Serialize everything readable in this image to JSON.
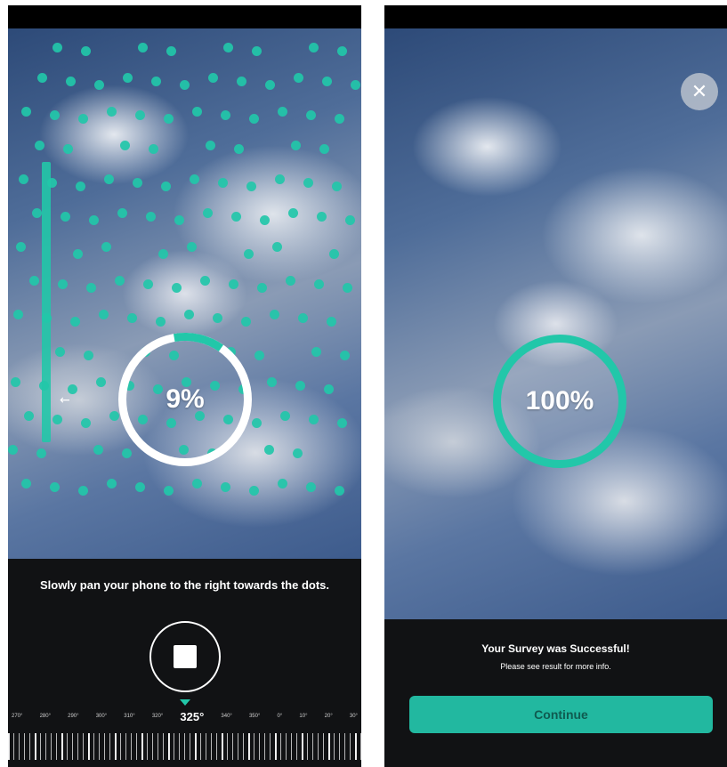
{
  "left_screen": {
    "progress_label": "9%",
    "progress_value": 0.09,
    "instruction": "Slowly pan your phone to the right towards the dots.",
    "compass": {
      "labels": [
        "270°",
        "280°",
        "290°",
        "300°",
        "310°",
        "320°",
        "325°",
        "340°",
        "350°",
        "0°",
        "10°",
        "20°",
        "30°"
      ],
      "current": "325°"
    },
    "stop_button_icon": "stop-icon"
  },
  "right_screen": {
    "progress_label": "100%",
    "progress_value": 1.0,
    "close_icon": "close-icon",
    "success_title": "Your Survey was Successful!",
    "success_subtitle": "Please see result for more info.",
    "continue_label": "Continue"
  },
  "colors": {
    "accent": "#22c7a9",
    "button": "#22b8a0",
    "panel": "#111214"
  }
}
